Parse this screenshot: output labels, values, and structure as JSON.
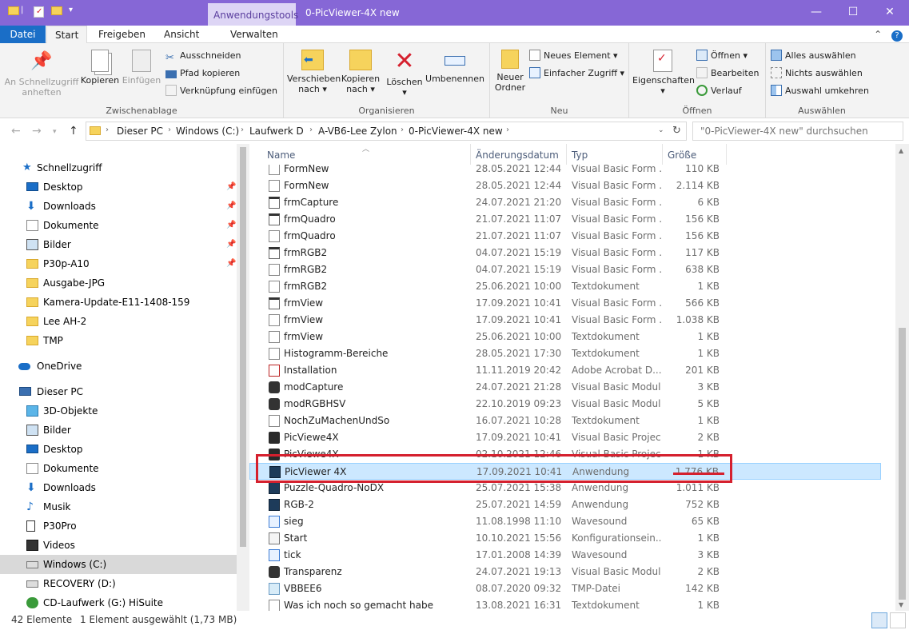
{
  "window": {
    "title": "0-PicViewer-4X new",
    "context_tab": "Anwendungstools"
  },
  "tabs": [
    "Datei",
    "Start",
    "Freigeben",
    "Ansicht",
    "Verwalten"
  ],
  "ribbon": {
    "zwischenablage": {
      "label": "Zwischenablage",
      "pin": "An Schnellzugriff anheften",
      "kopieren": "Kopieren",
      "einfuegen": "Einfügen",
      "ausschneiden": "Ausschneiden",
      "pfad": "Pfad kopieren",
      "verknuepfung": "Verknüpfung einfügen"
    },
    "organisieren": {
      "label": "Organisieren",
      "verschieben": "Verschieben nach",
      "kopieren_nach": "Kopieren nach",
      "loeschen": "Löschen",
      "umbenennen": "Umbenennen"
    },
    "neu": {
      "label": "Neu",
      "ordner": "Neuer Ordner",
      "element": "Neues Element",
      "zugriff": "Einfacher Zugriff"
    },
    "oeffnen": {
      "label": "Öffnen",
      "eigenschaften": "Eigenschaften",
      "oeffnen": "Öffnen",
      "bearbeiten": "Bearbeiten",
      "verlauf": "Verlauf"
    },
    "auswaehlen": {
      "label": "Auswählen",
      "alle": "Alles auswählen",
      "nichts": "Nichts auswählen",
      "umkehren": "Auswahl umkehren"
    }
  },
  "address": {
    "crumbs": [
      "Dieser PC",
      "Windows (C:)",
      "Laufwerk  D",
      "A-VB6-Lee Zylon",
      "0-PicViewer-4X new"
    ],
    "search_placeholder": "\"0-PicViewer-4X new\" durchsuchen"
  },
  "nav": {
    "quick": "Schnellzugriff",
    "quick_items": [
      "Desktop",
      "Downloads",
      "Dokumente",
      "Bilder",
      "P30p-A10",
      "Ausgabe-JPG",
      "Kamera-Update-E11-1408-159",
      "Lee AH-2",
      "TMP"
    ],
    "onedrive": "OneDrive",
    "pc": "Dieser PC",
    "pc_items": [
      "3D-Objekte",
      "Bilder",
      "Desktop",
      "Dokumente",
      "Downloads",
      "Musik",
      "P30Pro",
      "Videos",
      "Windows (C:)",
      "RECOVERY (D:)",
      "CD-Laufwerk (G:) HiSuite"
    ]
  },
  "columns": {
    "name": "Name",
    "date": "Änderungsdatum",
    "type": "Typ",
    "size": "Größe"
  },
  "files": [
    {
      "name": "FormNew",
      "date": "28.05.2021 12:44",
      "type": "Visual Basic Form ...",
      "size": "110 KB",
      "icon": "doc"
    },
    {
      "name": "FormNew",
      "date": "28.05.2021 12:44",
      "type": "Visual Basic Form ...",
      "size": "2.114 KB",
      "icon": "doc"
    },
    {
      "name": "frmCapture",
      "date": "24.07.2021 21:20",
      "type": "Visual Basic Form ...",
      "size": "6 KB",
      "icon": "form"
    },
    {
      "name": "frmQuadro",
      "date": "21.07.2021 11:07",
      "type": "Visual Basic Form ...",
      "size": "156 KB",
      "icon": "form"
    },
    {
      "name": "frmQuadro",
      "date": "21.07.2021 11:07",
      "type": "Visual Basic Form ...",
      "size": "156 KB",
      "icon": "doc"
    },
    {
      "name": "frmRGB2",
      "date": "04.07.2021 15:19",
      "type": "Visual Basic Form ...",
      "size": "117 KB",
      "icon": "form"
    },
    {
      "name": "frmRGB2",
      "date": "04.07.2021 15:19",
      "type": "Visual Basic Form ...",
      "size": "638 KB",
      "icon": "doc"
    },
    {
      "name": "frmRGB2",
      "date": "25.06.2021 10:00",
      "type": "Textdokument",
      "size": "1 KB",
      "icon": "doc"
    },
    {
      "name": "frmView",
      "date": "17.09.2021 10:41",
      "type": "Visual Basic Form ...",
      "size": "566 KB",
      "icon": "form"
    },
    {
      "name": "frmView",
      "date": "17.09.2021 10:41",
      "type": "Visual Basic Form ...",
      "size": "1.038 KB",
      "icon": "doc"
    },
    {
      "name": "frmView",
      "date": "25.06.2021 10:00",
      "type": "Textdokument",
      "size": "1 KB",
      "icon": "doc"
    },
    {
      "name": "Histogramm-Bereiche",
      "date": "28.05.2021 17:30",
      "type": "Textdokument",
      "size": "1 KB",
      "icon": "doc"
    },
    {
      "name": "Installation",
      "date": "11.11.2019 20:42",
      "type": "Adobe Acrobat D...",
      "size": "201 KB",
      "icon": "pdf"
    },
    {
      "name": "modCapture",
      "date": "24.07.2021 21:28",
      "type": "Visual Basic Module",
      "size": "3 KB",
      "icon": "mod"
    },
    {
      "name": "modRGBHSV",
      "date": "22.10.2019 09:23",
      "type": "Visual Basic Module",
      "size": "5 KB",
      "icon": "mod"
    },
    {
      "name": "NochZuMachenUndSo",
      "date": "16.07.2021 10:28",
      "type": "Textdokument",
      "size": "1 KB",
      "icon": "doc"
    },
    {
      "name": "PicViewe4X",
      "date": "17.09.2021 10:41",
      "type": "Visual Basic Project",
      "size": "2 KB",
      "icon": "vbp"
    },
    {
      "name": "PicViewe4X",
      "date": "02.10.2021 12:46",
      "type": "Visual Basic Projec",
      "size": "1 KB",
      "icon": "vbp"
    },
    {
      "name": "PicViewer 4X",
      "date": "17.09.2021 10:41",
      "type": "Anwendung",
      "size": "1.776 KB",
      "icon": "exe",
      "selected": true
    },
    {
      "name": "Puzzle-Quadro-NoDX",
      "date": "25.07.2021 15:38",
      "type": "Anwendung",
      "size": "1.011 KB",
      "icon": "exe"
    },
    {
      "name": "RGB-2",
      "date": "25.07.2021 14:59",
      "type": "Anwendung",
      "size": "752 KB",
      "icon": "exe"
    },
    {
      "name": "sieg",
      "date": "11.08.1998 11:10",
      "type": "Wavesound",
      "size": "65 KB",
      "icon": "wav"
    },
    {
      "name": "Start",
      "date": "10.10.2021 15:56",
      "type": "Konfigurationsein...",
      "size": "1 KB",
      "icon": "cfg"
    },
    {
      "name": "tick",
      "date": "17.01.2008 14:39",
      "type": "Wavesound",
      "size": "3 KB",
      "icon": "wav"
    },
    {
      "name": "Transparenz",
      "date": "24.07.2021 19:13",
      "type": "Visual Basic Module",
      "size": "2 KB",
      "icon": "mod"
    },
    {
      "name": "VBBEE6",
      "date": "08.07.2020 09:32",
      "type": "TMP-Datei",
      "size": "142 KB",
      "icon": "tmp"
    },
    {
      "name": "Was ich noch so gemacht habe",
      "date": "13.08.2021 16:31",
      "type": "Textdokument",
      "size": "1 KB",
      "icon": "doc"
    }
  ],
  "status": {
    "count": "42 Elemente",
    "selection": "1 Element ausgewählt (1,73 MB)"
  },
  "colors": {
    "titlebar": "#8667d6",
    "selection": "#cce8ff",
    "highlight": "#d5202e"
  }
}
